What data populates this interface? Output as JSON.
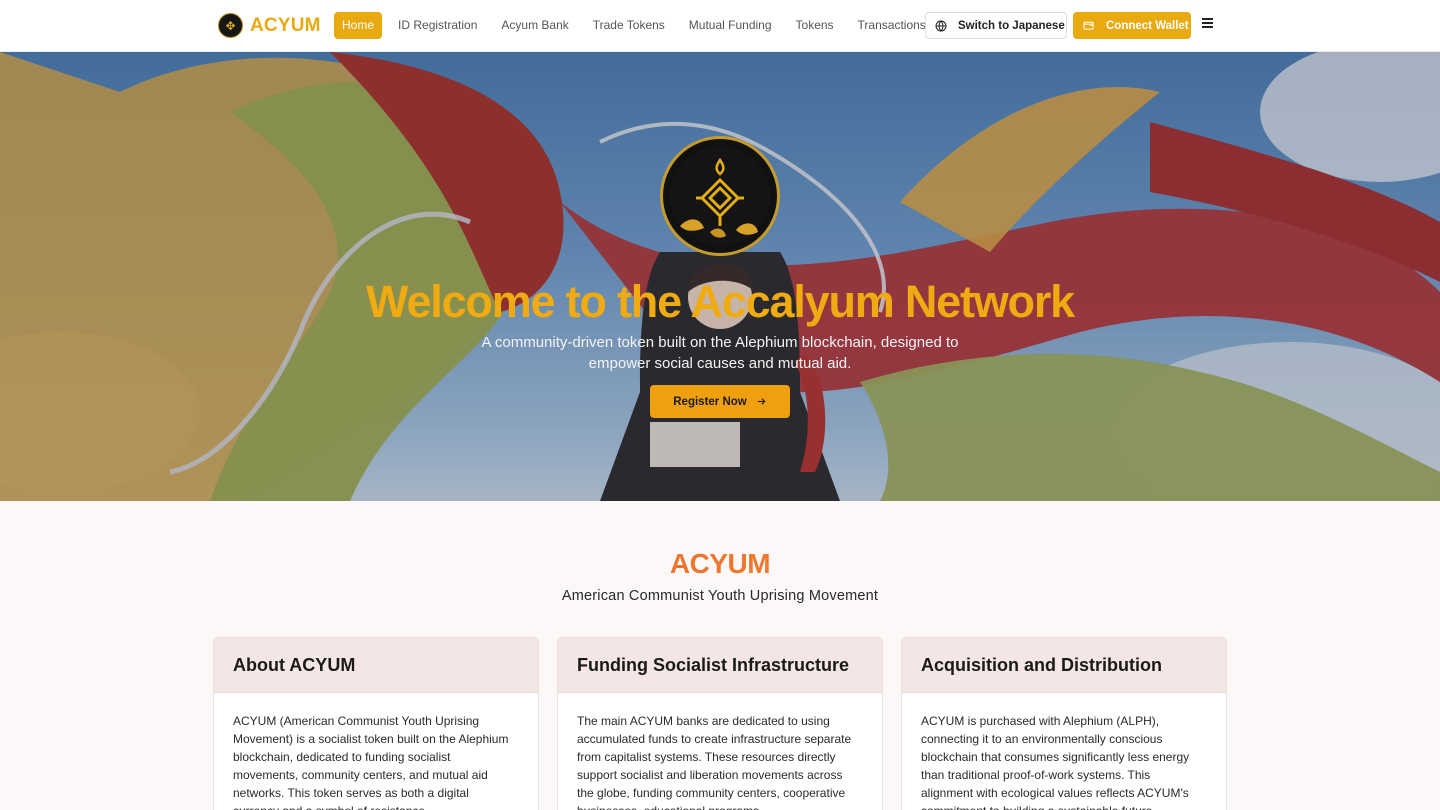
{
  "nav": {
    "brand": "ACYUM",
    "links": [
      "Home",
      "ID Registration",
      "Acyum Bank",
      "Trade Tokens",
      "Mutual Funding",
      "Tokens",
      "Transactions"
    ],
    "active_index": 0,
    "language_button": "Switch to Japanese",
    "wallet_button": "Connect Wallet"
  },
  "hero": {
    "title": "Welcome to the Accalyum Network",
    "subtitle": "A community-driven token built on the Alephium blockchain, designed to empower social causes and mutual aid.",
    "cta": "Register Now"
  },
  "section": {
    "title": "ACYUM",
    "subtitle": "American Communist Youth Uprising Movement"
  },
  "cards": [
    {
      "title": "About ACYUM",
      "body": "ACYUM (American Communist Youth Uprising Movement) is a socialist token built on the Alephium blockchain, dedicated to funding socialist movements, community centers, and mutual aid networks. This token serves as both a digital currency and a symbol of resistance."
    },
    {
      "title": "Funding Socialist Infrastructure",
      "body": "The main ACYUM banks are dedicated to using accumulated funds to create infrastructure separate from capitalist systems. These resources directly support socialist and liberation movements across the globe, funding community centers, cooperative businesses, educational programs."
    },
    {
      "title": "Acquisition and Distribution",
      "body": "ACYUM is purchased with Alephium (ALPH), connecting it to an environmentally conscious blockchain that consumes significantly less energy than traditional proof-of-work systems. This alignment with ecological values reflects ACYUM's commitment to building a sustainable future."
    }
  ],
  "colors": {
    "accent": "#e9a911",
    "hero_title": "#f0aa12",
    "cta": "#f09f0e",
    "card_header": "#f3e6e5"
  },
  "icons": {
    "brand": "acyum-emblem-icon",
    "language": "globe-icon",
    "wallet": "wallet-icon",
    "menu": "hamburger-menu-icon",
    "cta": "arrow-right-icon"
  }
}
